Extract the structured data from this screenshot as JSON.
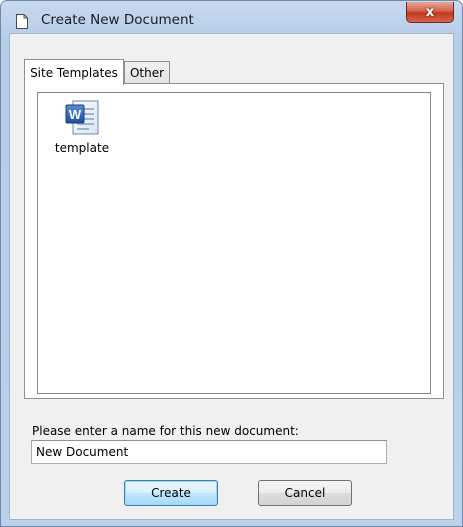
{
  "window": {
    "title": "Create New Document",
    "close_glyph": "x"
  },
  "icons": {
    "title_icon": "blank-document-icon",
    "file_icon": "word-document-icon",
    "close_icon": "close-icon"
  },
  "tabs": [
    {
      "label": "Site Templates",
      "active": true
    },
    {
      "label": "Other",
      "active": false
    }
  ],
  "templates": [
    {
      "label": "template",
      "icon": "word-document-icon"
    }
  ],
  "form": {
    "prompt": "Please enter a name for this new document:",
    "name_value": "New Document"
  },
  "buttons": {
    "create_label": "Create",
    "cancel_label": "Cancel"
  },
  "colors": {
    "title_bar": "#c6d9ef",
    "close_button": "#c7432b",
    "default_button_border": "#3c7fb1",
    "word_blue": "#2b5797"
  }
}
